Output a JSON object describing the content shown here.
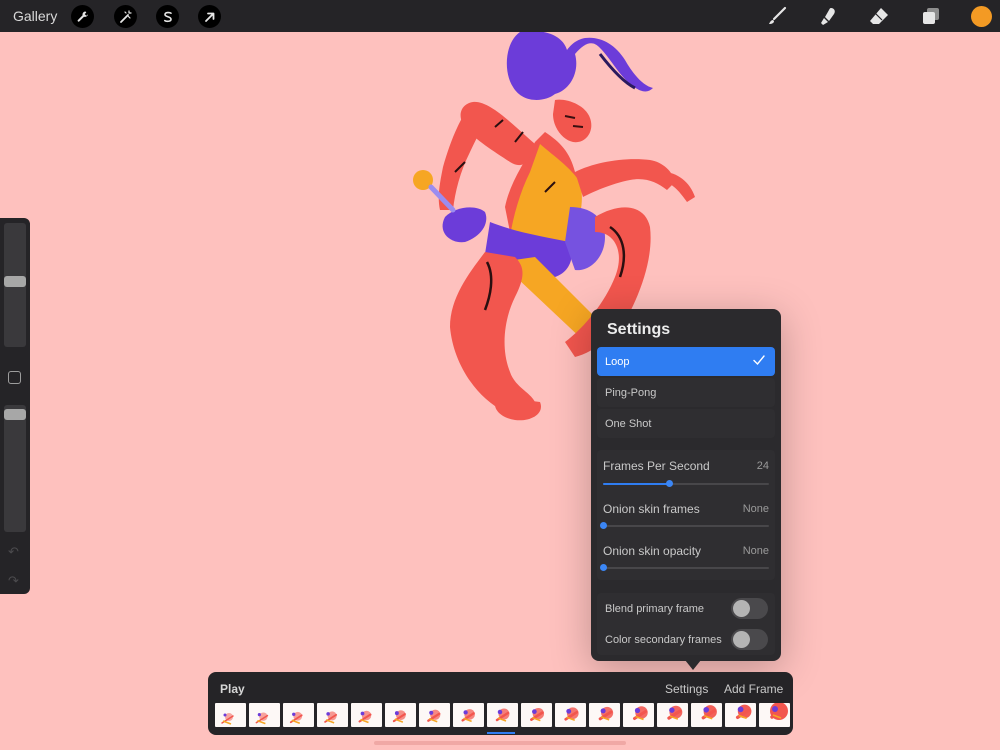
{
  "topbar": {
    "gallery_label": "Gallery",
    "left_tools": [
      "wrench-icon",
      "magic-wand-icon",
      "selection-s-icon",
      "transform-arrow-icon"
    ],
    "right_tools": [
      "brush-icon",
      "smudge-icon",
      "eraser-icon",
      "layers-icon"
    ],
    "current_color": "#f39a24"
  },
  "canvas": {
    "background": "#fec1be"
  },
  "settings": {
    "title": "Settings",
    "playback_modes": [
      {
        "label": "Loop",
        "selected": true
      },
      {
        "label": "Ping-Pong",
        "selected": false
      },
      {
        "label": "One Shot",
        "selected": false
      }
    ],
    "sliders": [
      {
        "label": "Frames Per Second",
        "value": "24",
        "fraction": 0.4
      },
      {
        "label": "Onion skin frames",
        "value": "None",
        "fraction": 0
      },
      {
        "label": "Onion skin opacity",
        "value": "None",
        "fraction": 0
      }
    ],
    "toggles": [
      {
        "label": "Blend primary frame",
        "on": false
      },
      {
        "label": "Color secondary frames",
        "on": false
      }
    ]
  },
  "timeline": {
    "play_label": "Play",
    "settings_label": "Settings",
    "add_frame_label": "Add Frame",
    "frame_count": 17,
    "current_frame": 9
  }
}
